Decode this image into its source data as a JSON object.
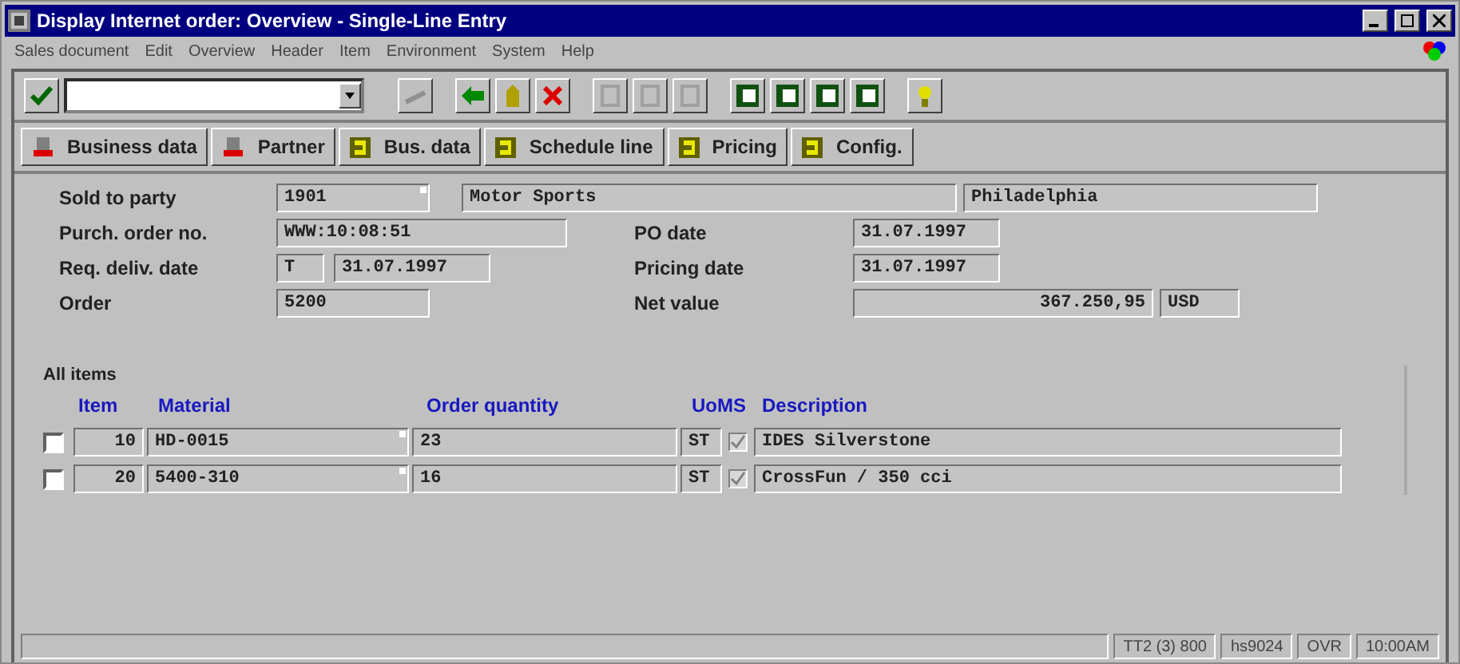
{
  "window": {
    "title": "Display Internet order: Overview - Single-Line Entry"
  },
  "menu": [
    "Sales document",
    "Edit",
    "Overview",
    "Header",
    "Item",
    "Environment",
    "System",
    "Help"
  ],
  "tab_buttons": [
    {
      "label": "Business data",
      "kind": "header"
    },
    {
      "label": "Partner",
      "kind": "header"
    },
    {
      "label": "Bus. data",
      "kind": "item"
    },
    {
      "label": "Schedule line",
      "kind": "item"
    },
    {
      "label": "Pricing",
      "kind": "item"
    },
    {
      "label": "Config.",
      "kind": "item"
    }
  ],
  "header": {
    "sold_to_party": {
      "label": "Sold to party",
      "number": "1901",
      "name": "Motor Sports",
      "city": "Philadelphia"
    },
    "purchase_order": {
      "label": "Purch. order no.",
      "value": "WWW:10:08:51"
    },
    "po_date": {
      "label": "PO date",
      "value": "31.07.1997"
    },
    "req_deliv_date": {
      "label": "Req. deliv. date",
      "type": "T",
      "value": "31.07.1997"
    },
    "pricing_date": {
      "label": "Pricing date",
      "value": "31.07.1997"
    },
    "order": {
      "label": "Order",
      "value": "5200"
    },
    "net_value": {
      "label": "Net value",
      "value": "367.250,95",
      "currency": "USD"
    }
  },
  "items": {
    "title": "All items",
    "columns": [
      "Item",
      "Material",
      "Order quantity",
      "UoMS",
      "Description"
    ],
    "rows": [
      {
        "selected": false,
        "item": "10",
        "material": "HD-0015",
        "quantity": "23",
        "uom": "ST",
        "checked": true,
        "description": "IDES Silverstone"
      },
      {
        "selected": false,
        "item": "20",
        "material": "5400-310",
        "quantity": "16",
        "uom": "ST",
        "checked": true,
        "description": "CrossFun / 350 cci"
      }
    ]
  },
  "status_bar": [
    "TT2 (3) 800",
    "hs9024",
    "OVR",
    "10:00AM"
  ]
}
